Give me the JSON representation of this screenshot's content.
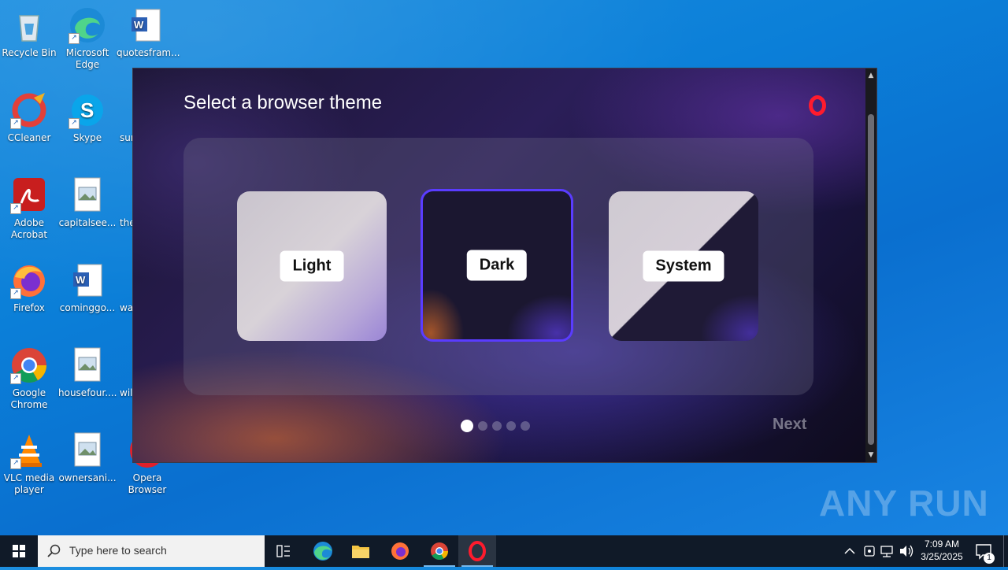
{
  "desktop": {
    "icons": [
      {
        "label": "Recycle Bin",
        "icon": "recycle-bin-icon"
      },
      {
        "label": "Microsoft Edge",
        "icon": "edge-icon"
      },
      {
        "label": "quotesfram...",
        "icon": "word-doc-icon"
      },
      {
        "label": "CCleaner",
        "icon": "ccleaner-icon"
      },
      {
        "label": "Skype",
        "icon": "skype-icon"
      },
      {
        "label": "sur",
        "icon": "file-icon"
      },
      {
        "label": "Adobe Acrobat",
        "icon": "acrobat-icon"
      },
      {
        "label": "capitalsee...",
        "icon": "image-file-icon"
      },
      {
        "label": "the",
        "icon": "file-icon"
      },
      {
        "label": "Firefox",
        "icon": "firefox-icon"
      },
      {
        "label": "cominggo...",
        "icon": "word-doc-icon"
      },
      {
        "label": "wa",
        "icon": "file-icon"
      },
      {
        "label": "Google Chrome",
        "icon": "chrome-icon"
      },
      {
        "label": "housefour....",
        "icon": "image-file-icon"
      },
      {
        "label": "wil",
        "icon": "file-icon"
      },
      {
        "label": "VLC media player",
        "icon": "vlc-icon"
      },
      {
        "label": "ownersani...",
        "icon": "image-file-icon"
      },
      {
        "label": "Opera Browser",
        "icon": "opera-icon"
      }
    ]
  },
  "installer": {
    "title": "Select a browser theme",
    "themes": [
      {
        "label": "Light",
        "selected": false
      },
      {
        "label": "Dark",
        "selected": true
      },
      {
        "label": "System",
        "selected": false
      }
    ],
    "pagination": {
      "total": 5,
      "current": 1
    },
    "next_label": "Next",
    "colors": {
      "accent": "#5a3cff",
      "opera_red": "#ff1b2d"
    }
  },
  "watermark": "ANY RUN",
  "taskbar": {
    "search_placeholder": "Type here to search",
    "apps": [
      "task-view-icon",
      "edge-icon",
      "file-explorer-icon",
      "firefox-icon",
      "chrome-icon",
      "opera-icon"
    ],
    "clock_time": "7:09 AM",
    "clock_date": "3/25/2025",
    "notification_count": "1"
  }
}
